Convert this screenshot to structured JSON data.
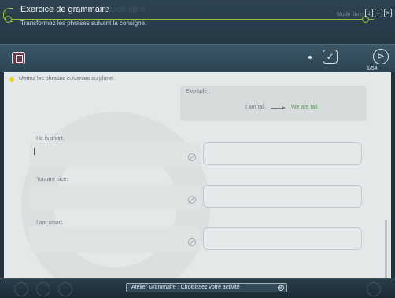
{
  "app": {
    "title": "Exercice de grammaire",
    "subtitle": "Transformez les phrases suivant la consigne.",
    "mode": "Mode libre",
    "window_buttons": [
      "↓",
      "–",
      "×"
    ]
  },
  "toolbar": {
    "check_icon": "✓",
    "next_icon": "⊳",
    "counter": "1/54"
  },
  "exercise": {
    "instruction": "Mettez les phrases suivantes au pluriel.",
    "example": {
      "label": "Exemple :",
      "source": "I am tall.",
      "target": "We are tall."
    },
    "items": [
      {
        "prompt": "He is short.",
        "input_value": "",
        "answer": ""
      },
      {
        "prompt": "You are nice.",
        "input_value": "",
        "answer": ""
      },
      {
        "prompt": "I am smart.",
        "input_value": "",
        "answer": ""
      }
    ]
  },
  "footer": {
    "activity_select": "Atelier Grammaire : Choisissez votre activité",
    "select_icon": "⊕"
  },
  "colors": {
    "accent_green": "#9bc23c",
    "example_answer": "#4da34a",
    "instruction_dot": "#e9d318"
  }
}
